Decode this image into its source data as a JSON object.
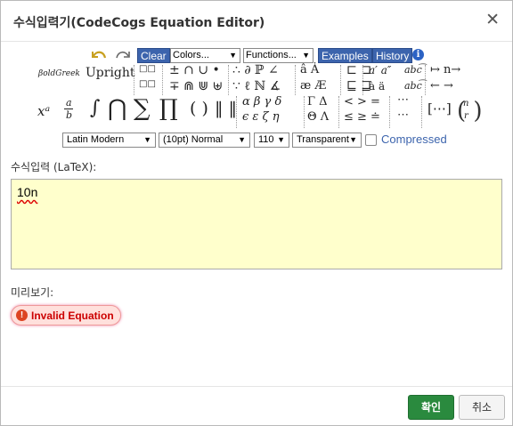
{
  "dialog": {
    "title": "수식입력기(CodeCogs Equation Editor)",
    "close_glyph": "✕"
  },
  "toolbar": {
    "undo_icon": "undo-icon",
    "redo_icon": "redo-icon",
    "clear_label": "Clear",
    "colors_label": "Colors...",
    "functions_label": "Functions...",
    "examples_label": "Examples",
    "history_label": "History",
    "info_glyph": "i",
    "font_bold_greek": "βoldGreek",
    "font_upright": "Upright",
    "sym_boxes1": "□□",
    "sym_boxes2": "□□",
    "sym_ops1": "± ∩ ∪ •",
    "sym_ops2": "∓ ⋒ ⋓ ⊎",
    "sym_rel1": "∴ ∂ ℙ ∠",
    "sym_rel2": "∵ ℓ ℕ ∡",
    "sym_acc1": "â  Ȧ",
    "sym_acc2": "æ  Æ",
    "sym_sq1": "⊏ ⊐",
    "sym_sq2": "⊑ ⊒",
    "sym_prime1": "a′  a″",
    "sym_prime2": "à  ä",
    "sym_abc1": "abc͡",
    "sym_abc2": "abc͡",
    "sym_arr1": "↦  n→",
    "sym_arr2": "←  →",
    "big_power": "xᵃ",
    "big_frac_top": "a",
    "big_frac_bot": "b",
    "big_int": "∫",
    "big_cap": "⋂",
    "big_sum": "∑",
    "big_prod": "∏",
    "big_paren": "( )",
    "big_norm": "‖ ‖",
    "greek1": "α  β  γ  δ",
    "greek2": "ϵ  ε  ζ  η",
    "Greek1": "Γ  Δ",
    "Greek2": "Θ  Λ",
    "ineq1": "<  >  =",
    "ineq2": "≤  ≥  ≐",
    "dots1": "⋯",
    "dots2": "⋯",
    "matrix": "[⋯]",
    "binom_top": "n",
    "binom_bot": "r"
  },
  "options": {
    "font": "Latin Modern",
    "size": "(10pt) Normal",
    "dpi": "110",
    "background": "Transparent",
    "compressed_label": "Compressed",
    "compressed_checked": false
  },
  "input": {
    "label": "수식입력 (LaTeX):",
    "value": "10n"
  },
  "preview": {
    "label": "미리보기:",
    "error_text": "Invalid Equation",
    "error_glyph": "!"
  },
  "footer": {
    "ok_label": "확인",
    "cancel_label": "취소"
  },
  "colors": {
    "accent_blue": "#3c64ad",
    "ok_green": "#2a8a3e",
    "latex_bg": "#ffffcc",
    "error_red": "#cc0000"
  }
}
